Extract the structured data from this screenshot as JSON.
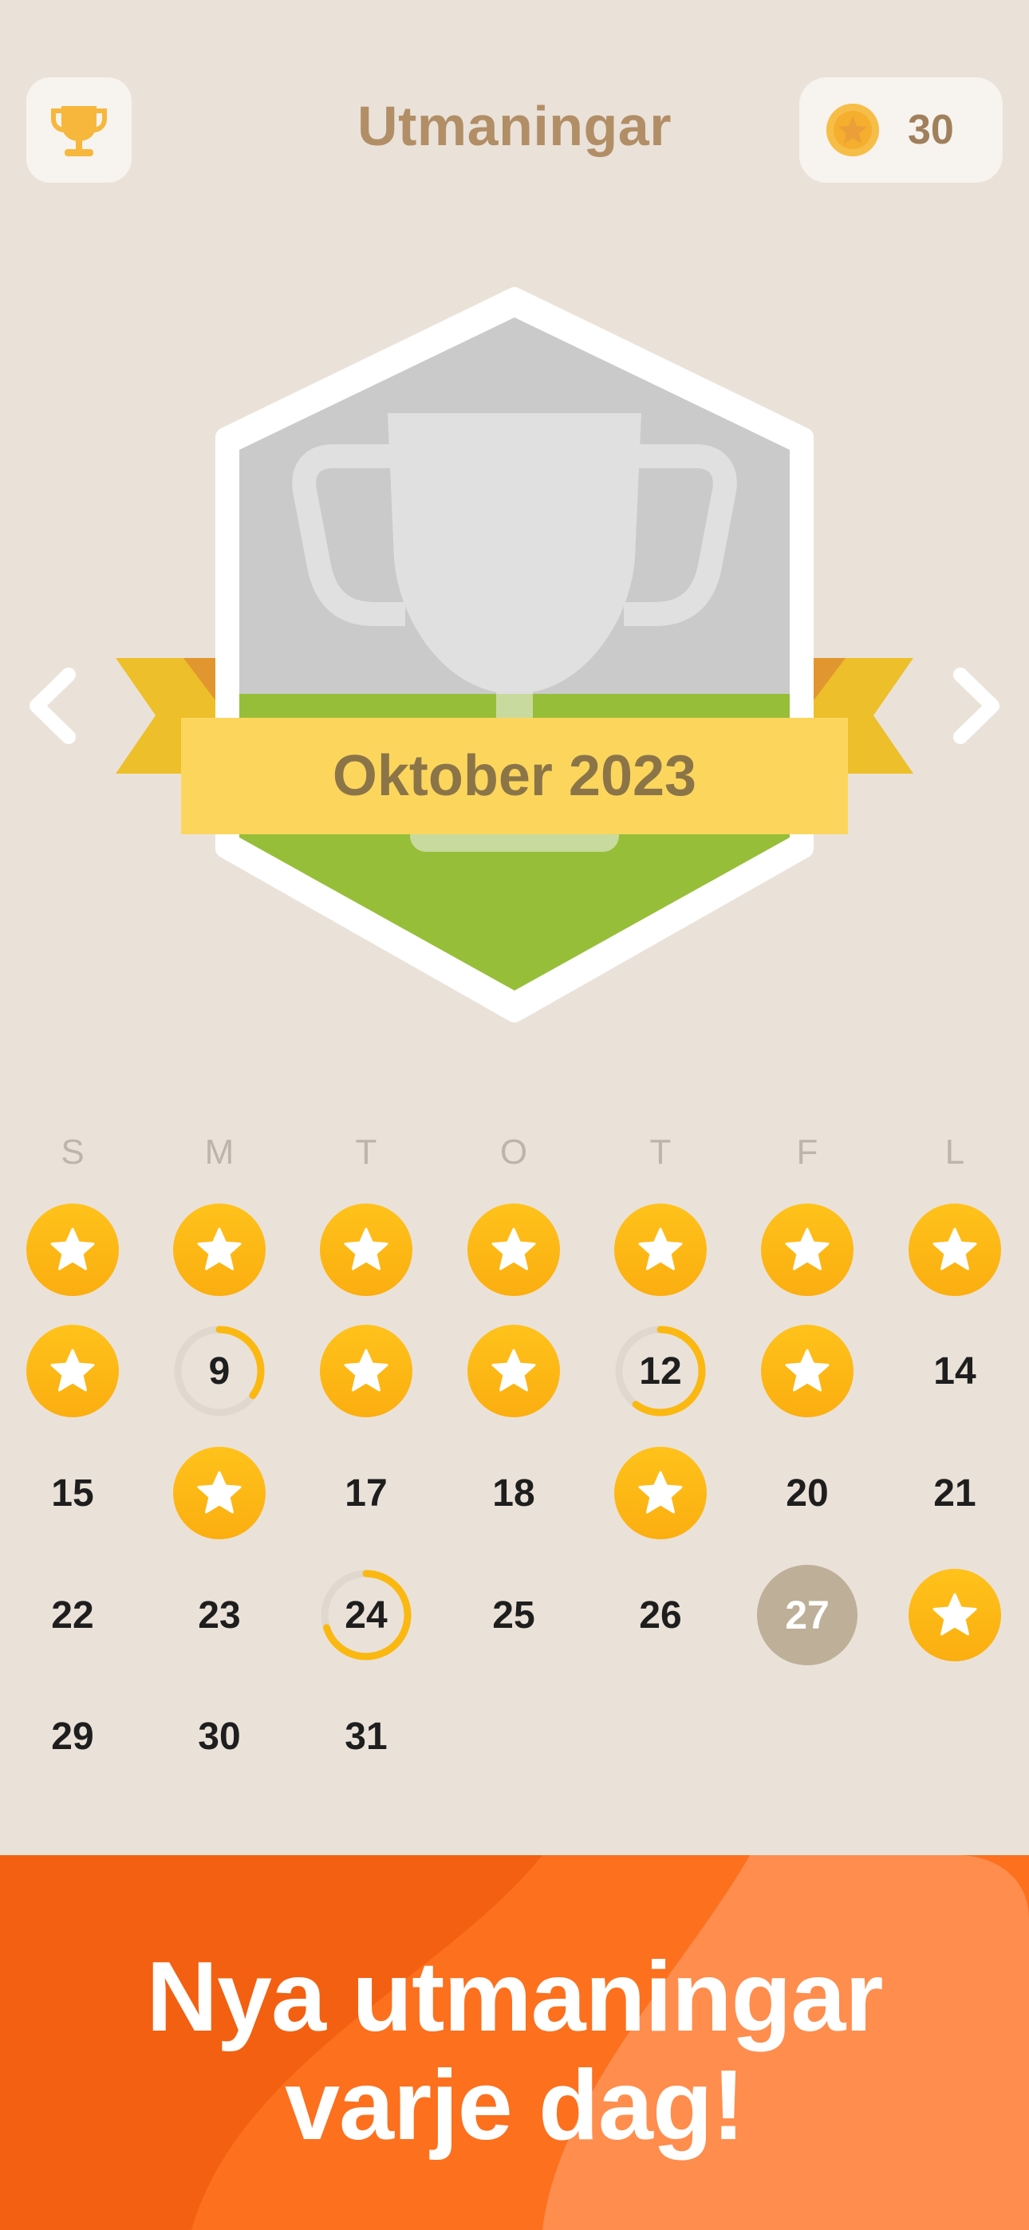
{
  "header": {
    "title": "Utmaningar",
    "coins": "30",
    "trophy_icon": "trophy-icon",
    "coin_icon": "coin-star-icon"
  },
  "badge": {
    "month_label": "Oktober 2023",
    "prev_icon": "chevron-left-icon",
    "next_icon": "chevron-right-icon"
  },
  "calendar": {
    "weekdays": [
      "S",
      "M",
      "T",
      "O",
      "T",
      "F",
      "L"
    ],
    "days": [
      {
        "day": "1",
        "status": "completed"
      },
      {
        "day": "2",
        "status": "completed"
      },
      {
        "day": "3",
        "status": "completed"
      },
      {
        "day": "4",
        "status": "completed"
      },
      {
        "day": "5",
        "status": "completed"
      },
      {
        "day": "6",
        "status": "completed"
      },
      {
        "day": "7",
        "status": "completed"
      },
      {
        "day": "8",
        "status": "completed"
      },
      {
        "day": "9",
        "status": "partial",
        "progress": 0.35
      },
      {
        "day": "10",
        "status": "completed"
      },
      {
        "day": "11",
        "status": "completed"
      },
      {
        "day": "12",
        "status": "partial",
        "progress": 0.6
      },
      {
        "day": "13",
        "status": "completed"
      },
      {
        "day": "14",
        "status": "none"
      },
      {
        "day": "15",
        "status": "none"
      },
      {
        "day": "16",
        "status": "completed"
      },
      {
        "day": "17",
        "status": "none"
      },
      {
        "day": "18",
        "status": "none"
      },
      {
        "day": "19",
        "status": "completed"
      },
      {
        "day": "20",
        "status": "none"
      },
      {
        "day": "21",
        "status": "none"
      },
      {
        "day": "22",
        "status": "none"
      },
      {
        "day": "23",
        "status": "none"
      },
      {
        "day": "24",
        "status": "partial",
        "progress": 0.7
      },
      {
        "day": "25",
        "status": "none"
      },
      {
        "day": "26",
        "status": "none"
      },
      {
        "day": "27",
        "status": "today"
      },
      {
        "day": "28",
        "status": "completed"
      },
      {
        "day": "29",
        "status": "none"
      },
      {
        "day": "30",
        "status": "none"
      },
      {
        "day": "31",
        "status": "none"
      }
    ]
  },
  "promo": {
    "line1": "Nya utmaningar",
    "line2": "varje dag!"
  },
  "colors": {
    "background": "#EAE2D9",
    "star_gold": "#FFBA18",
    "today": "#BEAF98",
    "promo_dark": "#F36011",
    "promo_light": "#FF8D4D"
  }
}
